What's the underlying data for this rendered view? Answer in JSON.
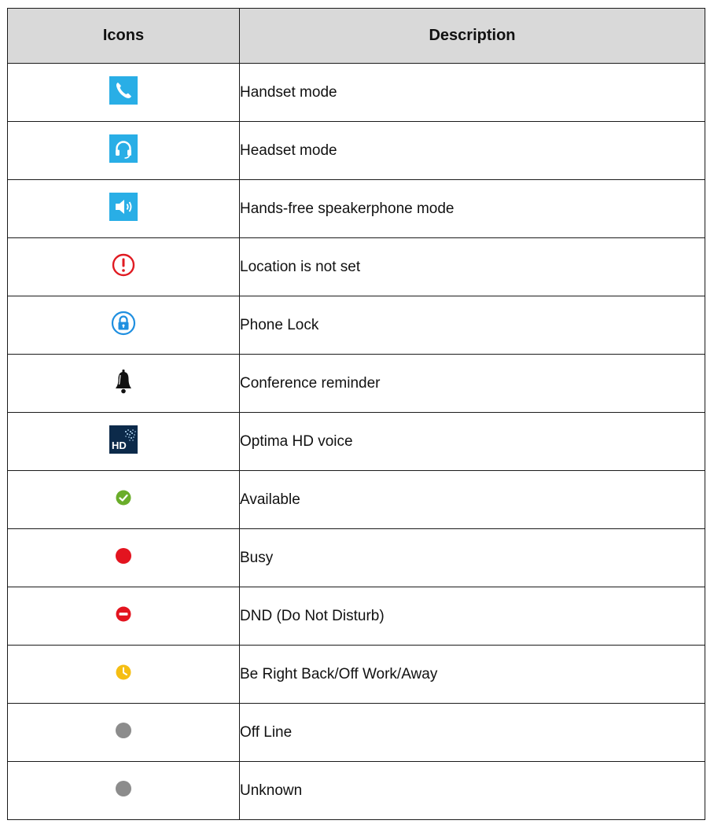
{
  "table": {
    "headers": {
      "icons": "Icons",
      "description": "Description"
    },
    "rows": [
      {
        "icon": "handset-icon",
        "description": "Handset mode"
      },
      {
        "icon": "headset-icon",
        "description": "Headset mode"
      },
      {
        "icon": "speaker-icon",
        "description": "Hands-free speakerphone mode"
      },
      {
        "icon": "location-warning-icon",
        "description": "Location is not set"
      },
      {
        "icon": "phone-lock-icon",
        "description": "Phone Lock"
      },
      {
        "icon": "bell-icon",
        "description": "Conference reminder"
      },
      {
        "icon": "hd-voice-icon",
        "description": "Optima HD voice",
        "icon_text": "HD"
      },
      {
        "icon": "available-status-icon",
        "description": "Available"
      },
      {
        "icon": "busy-status-icon",
        "description": "Busy"
      },
      {
        "icon": "dnd-status-icon",
        "description": "DND (Do Not Disturb)"
      },
      {
        "icon": "away-status-icon",
        "description": "Be Right Back/Off Work/Away"
      },
      {
        "icon": "offline-status-icon",
        "description": "Off Line"
      },
      {
        "icon": "unknown-status-icon",
        "description": "Unknown"
      }
    ]
  },
  "colors": {
    "header_bg": "#d9d9d9",
    "mode_icon_bg": "#29aee6",
    "warning_red": "#e01b22",
    "lock_blue": "#1f8fe0",
    "available_green": "#6aad2a",
    "busy_red": "#e3141f",
    "away_yellow": "#f5be13",
    "offline_gray": "#8c8c8c"
  }
}
